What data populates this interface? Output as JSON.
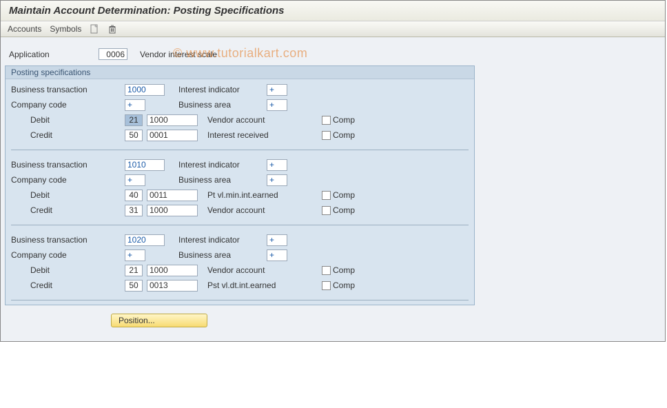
{
  "title": "Maintain Account Determination: Posting Specifications",
  "toolbar": {
    "accounts": "Accounts",
    "symbols": "Symbols"
  },
  "watermark": "© www.tutorialkart.com",
  "application": {
    "label": "Application",
    "value": "0006",
    "desc": "Vendor interest scale"
  },
  "group_title": "Posting specifications",
  "labels": {
    "bt": "Business transaction",
    "ii": "Interest indicator",
    "cc": "Company code",
    "ba": "Business area",
    "debit": "Debit",
    "credit": "Credit",
    "comp": "Comp"
  },
  "blocks": [
    {
      "bt": "1000",
      "ii": "+",
      "cc": "+",
      "ba": "+",
      "debit": {
        "pk": "21",
        "acct": "1000",
        "desc": "Vendor account",
        "comp": false,
        "pk_selected": true
      },
      "credit": {
        "pk": "50",
        "acct": "0001",
        "desc": "Interest received",
        "comp": false
      }
    },
    {
      "bt": "1010",
      "ii": "+",
      "cc": "+",
      "ba": "+",
      "debit": {
        "pk": "40",
        "acct": "0011",
        "desc": "Pt vl.min.int.earned",
        "comp": false
      },
      "credit": {
        "pk": "31",
        "acct": "1000",
        "desc": "Vendor account",
        "comp": false
      }
    },
    {
      "bt": "1020",
      "ii": "+",
      "cc": "+",
      "ba": "+",
      "debit": {
        "pk": "21",
        "acct": "1000",
        "desc": "Vendor account",
        "comp": false
      },
      "credit": {
        "pk": "50",
        "acct": "0013",
        "desc": "Pst vl.dt.int.earned",
        "comp": false
      }
    }
  ],
  "position_btn": "Position..."
}
